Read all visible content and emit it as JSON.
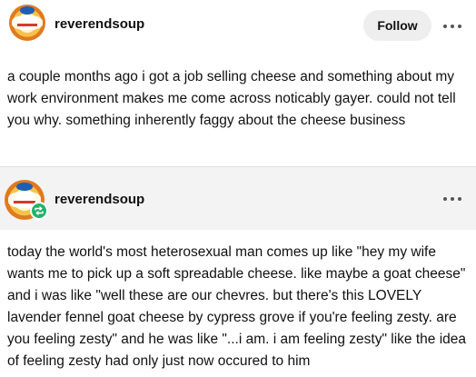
{
  "post": {
    "author": "reverendsoup",
    "follow_label": "Follow",
    "body": "a couple months ago i got a job selling cheese and something about my work environment makes me come across noticably gayer. could not tell you why. something inherently faggy about the cheese business"
  },
  "reblog": {
    "author": "reverendsoup",
    "body": "today the world's most heterosexual man comes up like \"hey my wife wants me to pick up a soft spreadable cheese. like maybe a goat cheese\" and i was like \"well these are our chevres. but there's this LOVELY lavender fennel goat cheese by cypress grove if you're feeling zesty. are you feeling zesty\" and he was like \"...i am. i am feeling zesty\" like the idea of feeling zesty had only just now occured to him"
  },
  "icons": {
    "more": "more-horizontal-icon",
    "reblog": "reblog-icon",
    "avatar": "avatar-image"
  },
  "colors": {
    "reblog_badge": "#1fb36a",
    "follow_bg": "#eeeeee",
    "reblog_header_bg": "#f3f3f3"
  }
}
